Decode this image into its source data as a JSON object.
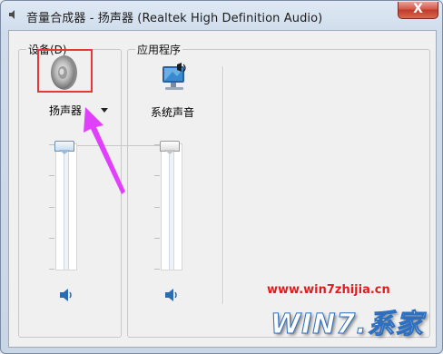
{
  "window": {
    "title": "音量合成器 - 扬声器 (Realtek High Definition Audio)",
    "close_label": "X"
  },
  "device_section": {
    "label": "设备(D)",
    "device_name": "扬声器",
    "volume_percent": 100,
    "muted": false
  },
  "apps_section": {
    "label": "应用程序",
    "apps": [
      {
        "name": "系统声音",
        "icon": "system-sounds-icon",
        "volume_percent": 100,
        "muted": false
      }
    ]
  },
  "annotation": {
    "highlight_color": "#e53935",
    "arrow_color": "#e040fb"
  },
  "watermark": {
    "url": "www.win7zhijia.cn",
    "logo": "WIN7.系家"
  },
  "colors": {
    "titlebar": "#cfdceb",
    "client": "#f0f0f0",
    "close_button": "#c0392b",
    "slider_thumb": "#c8dcf0"
  }
}
